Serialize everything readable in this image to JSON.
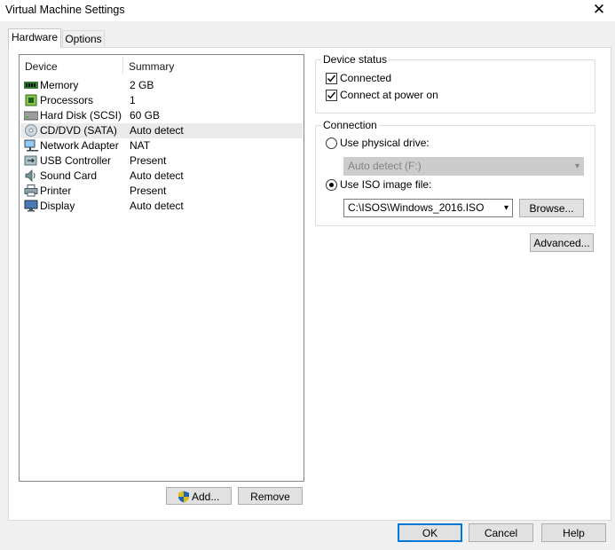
{
  "window": {
    "title": "Virtual Machine Settings"
  },
  "tabs": [
    {
      "label": "Hardware"
    },
    {
      "label": "Options"
    }
  ],
  "device_list": {
    "columns": {
      "device": "Device",
      "summary": "Summary"
    },
    "rows": [
      {
        "icon": "memory-icon",
        "device": "Memory",
        "summary": "2 GB"
      },
      {
        "icon": "processor-icon",
        "device": "Processors",
        "summary": "1"
      },
      {
        "icon": "hard-disk-icon",
        "device": "Hard Disk (SCSI)",
        "summary": "60 GB"
      },
      {
        "icon": "cd-dvd-icon",
        "device": "CD/DVD (SATA)",
        "summary": "Auto detect"
      },
      {
        "icon": "network-adapter-icon",
        "device": "Network Adapter",
        "summary": "NAT"
      },
      {
        "icon": "usb-icon",
        "device": "USB Controller",
        "summary": "Present"
      },
      {
        "icon": "sound-card-icon",
        "device": "Sound Card",
        "summary": "Auto detect"
      },
      {
        "icon": "printer-icon",
        "device": "Printer",
        "summary": "Present"
      },
      {
        "icon": "display-icon",
        "device": "Display",
        "summary": "Auto detect"
      }
    ],
    "selected_index": 3
  },
  "list_buttons": {
    "add": "Add...",
    "remove": "Remove"
  },
  "device_status": {
    "title": "Device status",
    "connected": {
      "label": "Connected",
      "checked": true
    },
    "connect_at_power_on": {
      "label": "Connect at power on",
      "checked": true
    }
  },
  "connection": {
    "title": "Connection",
    "physical_drive": {
      "label": "Use physical drive:",
      "selected": false,
      "value": "Auto detect (F:)"
    },
    "iso_image": {
      "label": "Use ISO image file:",
      "selected": true,
      "value": "C:\\ISOS\\Windows_2016.ISO"
    },
    "browse": "Browse..."
  },
  "advanced_button": "Advanced...",
  "footer": {
    "ok": "OK",
    "cancel": "Cancel",
    "help": "Help"
  },
  "colors": {
    "selection": "#eaeaea",
    "default_button_border": "#0078d7",
    "dialog_bg": "#f0f0f0"
  }
}
